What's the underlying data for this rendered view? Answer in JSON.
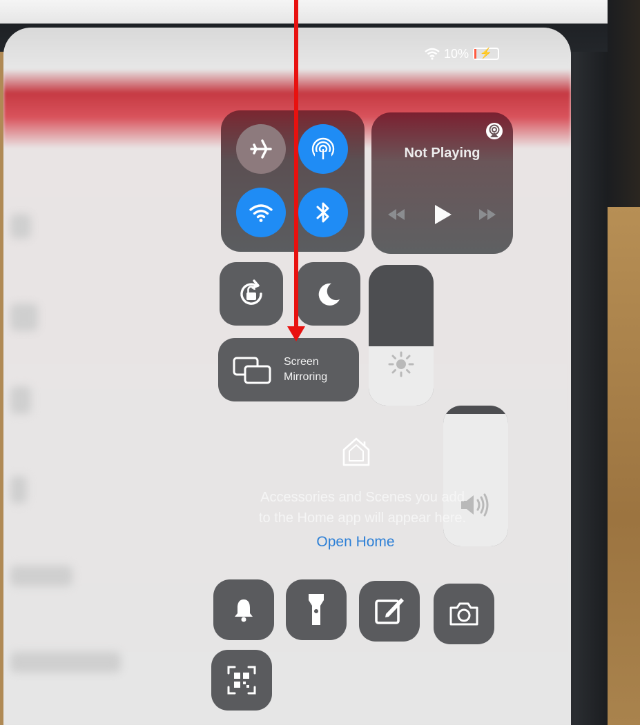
{
  "status_bar": {
    "battery_percent": "10%",
    "battery_level": 0.1,
    "battery_color": "#ff5a40",
    "icons": [
      "wifi-icon",
      "battery-charging-icon"
    ]
  },
  "connectivity": {
    "tiles": [
      {
        "name": "airplane-mode",
        "icon": "airplane-icon",
        "state": "off"
      },
      {
        "name": "airdrop",
        "icon": "airdrop-icon",
        "state": "on"
      },
      {
        "name": "wifi",
        "icon": "wifi-icon",
        "state": "on"
      },
      {
        "name": "bluetooth",
        "icon": "bluetooth-icon",
        "state": "on"
      }
    ],
    "active_color": "#1f8cf5"
  },
  "media": {
    "title": "Not Playing",
    "icons": [
      "airplay-audio-icon",
      "rewind-icon",
      "play-icon",
      "fast-forward-icon"
    ]
  },
  "toggles": {
    "rotation_lock_icon": "rotation-lock-icon",
    "do_not_disturb_icon": "moon-icon"
  },
  "screen_mirroring": {
    "label_line1": "Screen",
    "label_line2": "Mirroring",
    "icon": "screen-mirroring-icon"
  },
  "sliders": {
    "brightness_level": 0.42,
    "volume_level": 0.94,
    "icons": [
      "sun-icon",
      "speaker-icon"
    ]
  },
  "home": {
    "message_line1": "Accessories and Scenes you add",
    "message_line2": "to the Home app will appear here.",
    "open_home_label": "Open Home",
    "link_color": "#2c7fd6"
  },
  "shortcuts": [
    "bell-icon",
    "flashlight-icon",
    "notes-icon",
    "camera-icon",
    "qr-code-icon"
  ],
  "annotation": {
    "arrow_color": "#e8110f"
  }
}
